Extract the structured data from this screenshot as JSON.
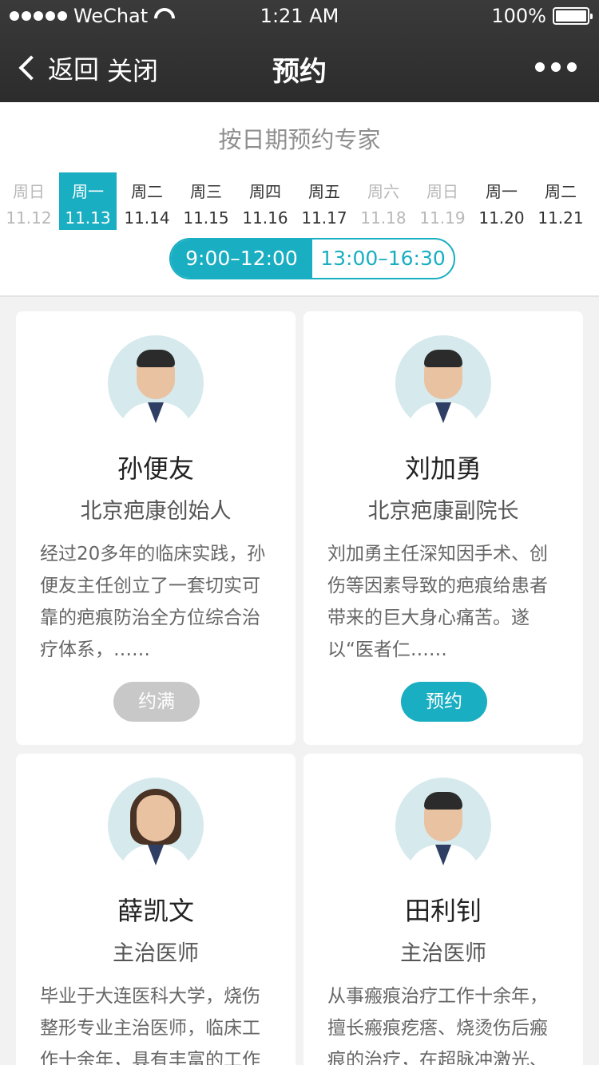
{
  "status_bar": {
    "signal_label": "WeChat",
    "time": "1:21 AM",
    "battery": "100%"
  },
  "nav": {
    "back_label": "返回",
    "close_label": "关闭",
    "title": "预约"
  },
  "date_section": {
    "heading": "按日期预约专家",
    "days": [
      {
        "weekday": "周日",
        "date": "11.12",
        "state": "disabled"
      },
      {
        "weekday": "周一",
        "date": "11.13",
        "state": "selected"
      },
      {
        "weekday": "周二",
        "date": "11.14",
        "state": "normal"
      },
      {
        "weekday": "周三",
        "date": "11.15",
        "state": "normal"
      },
      {
        "weekday": "周四",
        "date": "11.16",
        "state": "normal"
      },
      {
        "weekday": "周五",
        "date": "11.17",
        "state": "normal"
      },
      {
        "weekday": "周六",
        "date": "11.18",
        "state": "disabled"
      },
      {
        "weekday": "周日",
        "date": "11.19",
        "state": "disabled"
      },
      {
        "weekday": "周一",
        "date": "11.20",
        "state": "normal"
      },
      {
        "weekday": "周二",
        "date": "11.21",
        "state": "normal"
      }
    ],
    "time_slots": [
      {
        "label": "9:00–12:00",
        "selected": true
      },
      {
        "label": "13:00–16:30",
        "selected": false
      }
    ]
  },
  "doctors": [
    {
      "name": "孙便友",
      "title": "北京疤康创始人",
      "description": "经过20多年的临床实践，孙便友主任创立了一套切实可靠的疤痕防治全方位综合治疗体系，……",
      "button_label": "约满",
      "status": "full"
    },
    {
      "name": "刘加勇",
      "title": "北京疤康副院长",
      "description": "刘加勇主任深知因手术、创伤等因素导致的疤痕给患者带来的巨大身心痛苦。遂以“医者仁……",
      "button_label": "预约",
      "status": "available"
    },
    {
      "name": "薛凯文",
      "title": "主治医师",
      "description": "毕业于大连医科大学，烧伤整形专业主治医师，临床工作十余年，具有丰富的工作",
      "button_label": "",
      "status": ""
    },
    {
      "name": "田利钊",
      "title": "主治医师",
      "description": "从事瘢痕治疗工作十余年，擅长瘢痕疙瘩、烧烫伤后瘢痕的治疗，在超脉冲激光、",
      "button_label": "",
      "status": ""
    }
  ],
  "colors": {
    "accent": "#19aec2",
    "nav_bg": "#333333",
    "disabled_button": "#c8c8c8",
    "page_bg": "#f2f2f2"
  }
}
